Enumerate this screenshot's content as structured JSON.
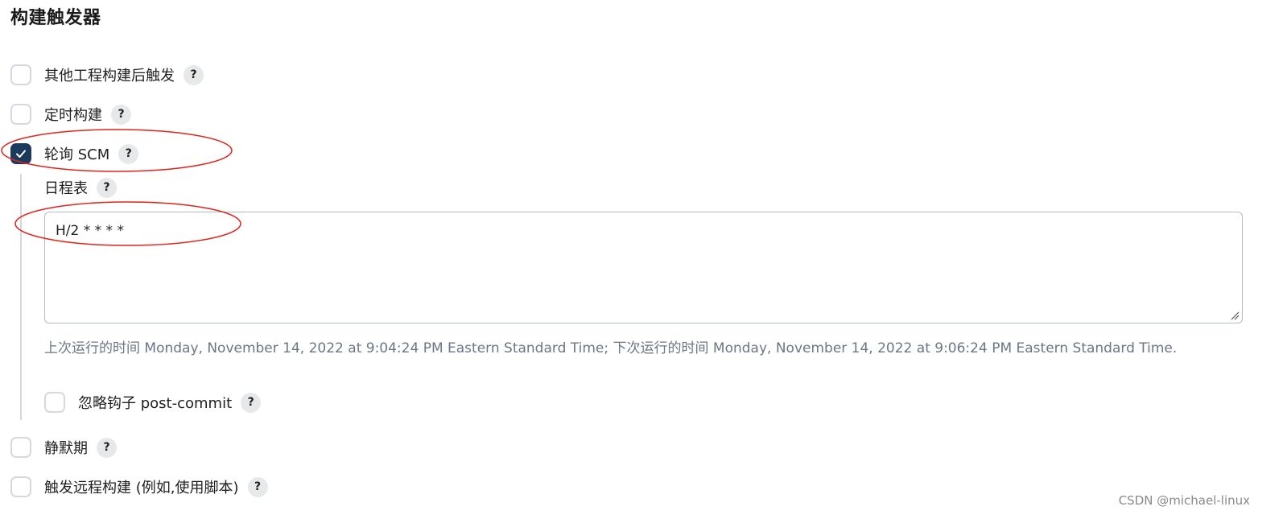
{
  "section": {
    "title": "构建触发器"
  },
  "triggers": {
    "after_other_projects": {
      "label": "其他工程构建后触发",
      "checked": false
    },
    "periodic_build": {
      "label": "定时构建",
      "checked": false
    },
    "poll_scm": {
      "label": "轮询 SCM",
      "checked": true
    },
    "quiet_period": {
      "label": "静默期",
      "checked": false
    },
    "remote_trigger": {
      "label": "触发远程构建 (例如,使用脚本)",
      "checked": false
    }
  },
  "poll_scm_options": {
    "schedule_label": "日程表",
    "schedule_value": "H/2 * * * *",
    "schedule_info": "上次运行的时间 Monday, November 14, 2022 at 9:04:24 PM Eastern Standard Time; 下次运行的时间 Monday, November 14, 2022 at 9:06:24 PM Eastern Standard Time.",
    "ignore_post_commit": {
      "label": "忽略钩子 post-commit",
      "checked": false
    }
  },
  "help_symbol": "?",
  "watermark": "CSDN @michael-linux",
  "colors": {
    "checkbox_checked": "#1c3a5e",
    "checkbox_border": "#d5d9dd",
    "annotation_red": "#e0241b",
    "info_text": "#6c7684"
  },
  "icons": {
    "check": "check-icon",
    "help": "help-icon",
    "resize": "resize-grip-icon"
  }
}
